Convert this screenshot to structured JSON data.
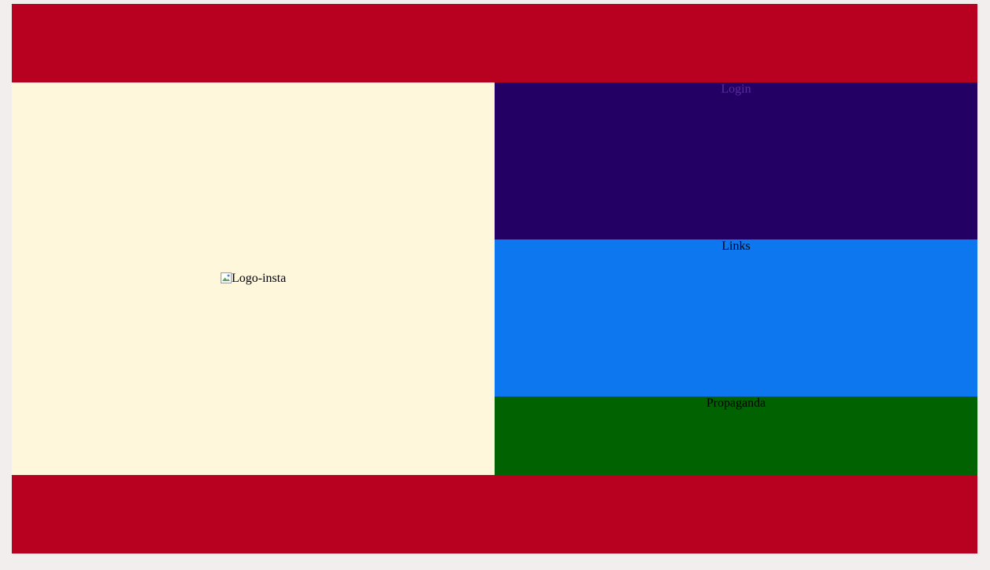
{
  "header": {},
  "main": {
    "logo_alt": "Logo-insta"
  },
  "sidebar": {
    "login_label": "Login",
    "links_label": "Links",
    "propaganda_label": "Propaganda"
  },
  "footer": {},
  "colors": {
    "page_bg": "#f3eeee",
    "header_bg": "#b80020",
    "footer_bg": "#b80020",
    "main_bg": "#fff7dc",
    "login_bg": "#230063",
    "links_bg": "#0d77f0",
    "propaganda_bg": "#006200"
  }
}
